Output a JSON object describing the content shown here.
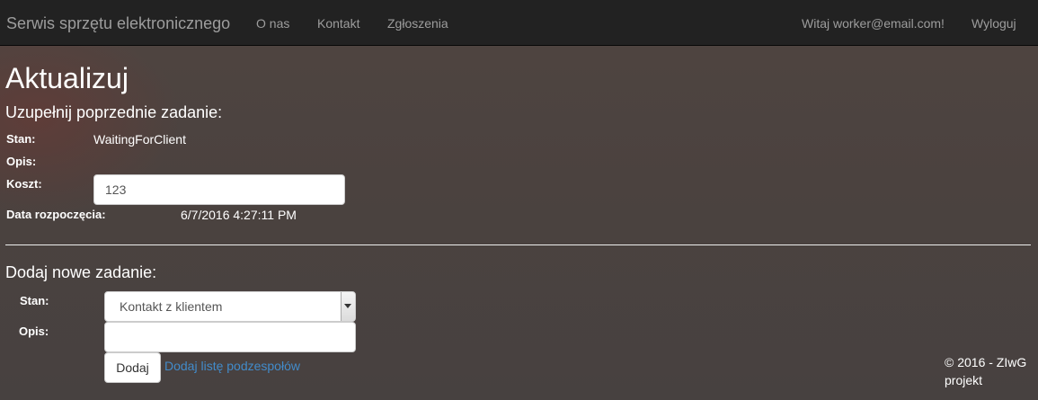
{
  "navbar": {
    "brand": "Serwis sprzętu elektronicznego",
    "links": [
      {
        "label": "O nas"
      },
      {
        "label": "Kontakt"
      },
      {
        "label": "Zgłoszenia"
      }
    ],
    "greeting": "Witaj worker@email.com!",
    "logout": "Wyloguj"
  },
  "page": {
    "title": "Aktualizuj"
  },
  "previous_task": {
    "heading": "Uzupełnij poprzednie zadanie:",
    "state_label": "Stan:",
    "state_value": "WaitingForClient",
    "description_label": "Opis:",
    "cost_label": "Koszt:",
    "cost_value": "123",
    "start_date_label": "Data rozpoczęcia:",
    "start_date_value": "6/7/2016 4:27:11 PM"
  },
  "new_task": {
    "heading": "Dodaj nowe zadanie:",
    "state_label": "Stan:",
    "state_selected": "Kontakt z klientem",
    "description_label": "Opis:",
    "description_value": "",
    "add_button": "Dodaj",
    "add_parts_link": "Dodaj listę podzespołów"
  },
  "footer": {
    "text": "© 2016 - ZIwG projekt"
  },
  "colors": {
    "navbar_bg": "#222222",
    "nav_text": "#9d9d9d",
    "link": "#428bca",
    "page_bg": "#4b423f"
  }
}
